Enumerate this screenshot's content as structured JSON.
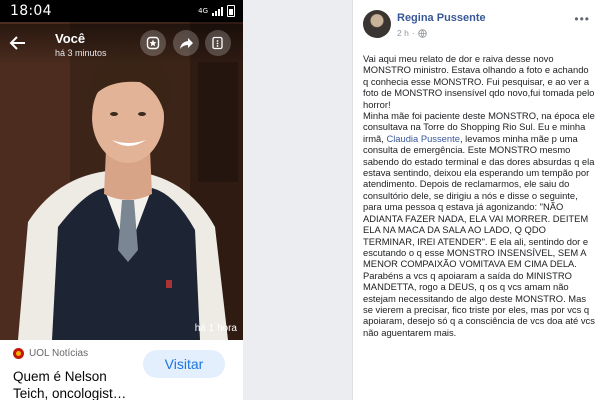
{
  "phone": {
    "status_time": "18:04",
    "network": "4G",
    "story": {
      "author": "Você",
      "posted": "há 3 minutos",
      "overlay_time": "há 1 hora"
    },
    "link_card": {
      "source": "UOL Notícias",
      "headline": "Quem é Nelson Teich, oncologist…",
      "visit_label": "Visitar"
    }
  },
  "post": {
    "author": "Regina Pussente",
    "time": "2 h",
    "body": {
      "p1": "Vai aqui meu relato de dor e raiva desse novo MONSTRO ministro. Estava olhando a foto e achando q conhecia esse MONSTRO. Fui pesquisar, e ao ver a foto de MONSTRO insensível qdo novo,fui tomada pelo horror!",
      "p2_a": "Minha mãe foi paciente deste MONSTRO, na época ele consultava na Torre do Shopping Rio Sul. Eu e minha irmã, ",
      "p2_link": "Claudia Pussente",
      "p2_b": ", levamos minha mãe p uma consulta de emergência. Este MONSTRO mesmo sabendo do estado terminal e das dores absurdas q ela estava sentindo, deixou ela esperando um tempão por atendimento. Depois de reclamarmos, ele saiu do consultório dele, se dirigiu a nós e disse o seguinte, para uma pessoa q estava já agonizando: \"NÃO ADIANTA FAZER NADA, ELA VAI MORRER. DEITEM ELA NA MACA DA SALA AO LADO, Q QDO TERMINAR, IREI ATENDER\". E ela ali, sentindo dor e escutando o q esse MONSTRO INSENSÍVEL, SEM A MENOR COMPAIXÃO VOMITAVA EM CIMA DELA.",
      "p3": "Parabéns a vcs q apoiaram a saída do MINISTRO MANDETTA, rogo a DEUS, q os q vcs amam não estejam necessitando de algo deste MONSTRO. Mas se vierem a precisar, fico triste por eles, mas por vcs q apoiaram, desejo só q a consciência de vcs doa até vcs não aguentarem mais."
    }
  },
  "colors": {
    "link": "#385898",
    "visit_bg": "#e4effd",
    "visit_text": "#1b74e4"
  }
}
